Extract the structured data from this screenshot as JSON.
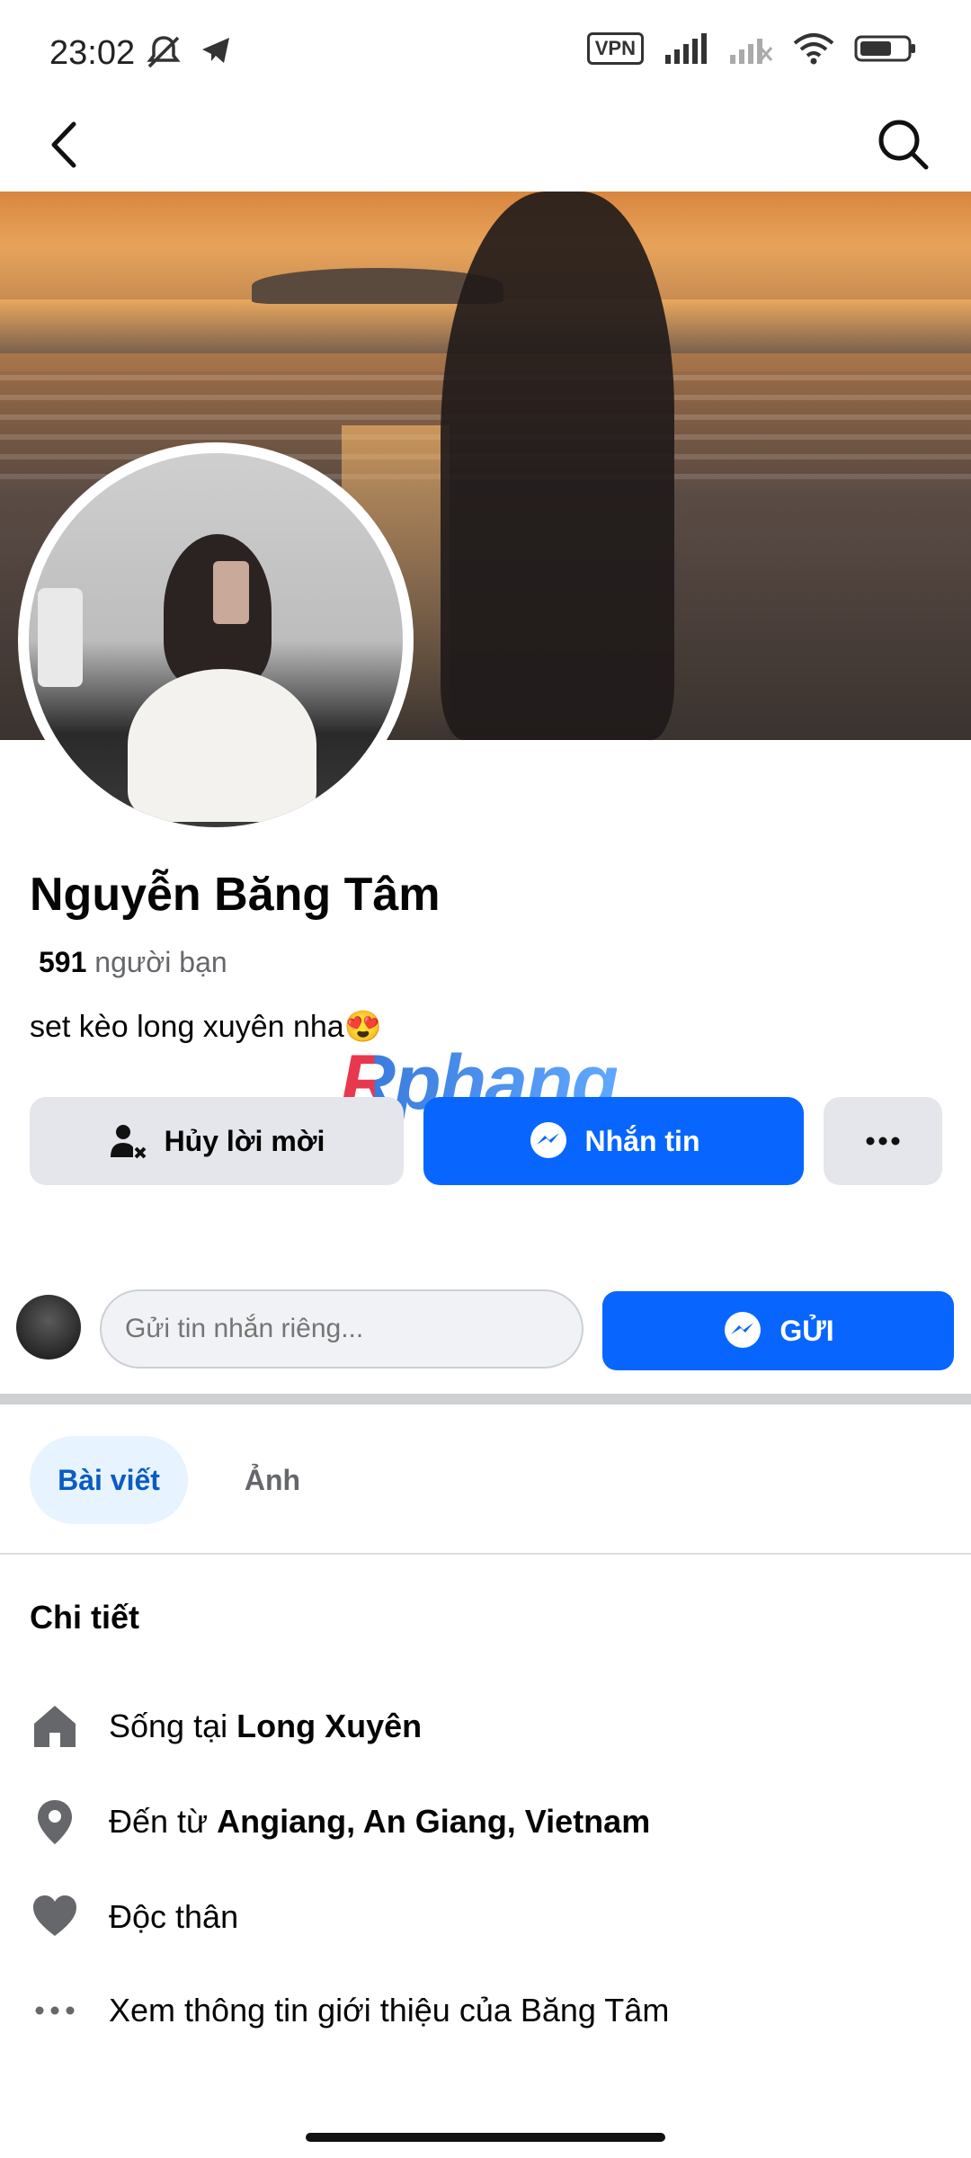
{
  "status_bar": {
    "time": "23:02",
    "vpn_label": "VPN",
    "icons": [
      "mute-icon",
      "telegram-icon",
      "signal-icon",
      "signal-2-icon",
      "wifi-icon",
      "battery-icon"
    ]
  },
  "profile": {
    "name": "Nguyễn Băng Tâm",
    "friends_count": "591",
    "friends_label": "người bạn",
    "bio": "set kèo long xuyên nha😍"
  },
  "watermark": "Rphang",
  "actions": {
    "cancel_request": "Hủy lời mời",
    "message": "Nhắn tin",
    "more": "···"
  },
  "private_message": {
    "placeholder": "Gửi tin nhắn riêng...",
    "send_label": "GỬI"
  },
  "tabs": [
    {
      "label": "Bài viết",
      "active": true
    },
    {
      "label": "Ảnh",
      "active": false
    }
  ],
  "details": {
    "title": "Chi tiết",
    "lives_prefix": "Sống tại ",
    "lives_value": "Long Xuyên",
    "from_prefix": "Đến từ ",
    "from_value": "Angiang, An Giang, Vietnam",
    "relationship": "Độc thân",
    "see_about": "Xem thông tin giới thiệu của Băng Tâm"
  },
  "colors": {
    "brand_blue": "#0866ff",
    "gray_button": "#e4e6eb",
    "secondary_text": "#65676b"
  }
}
